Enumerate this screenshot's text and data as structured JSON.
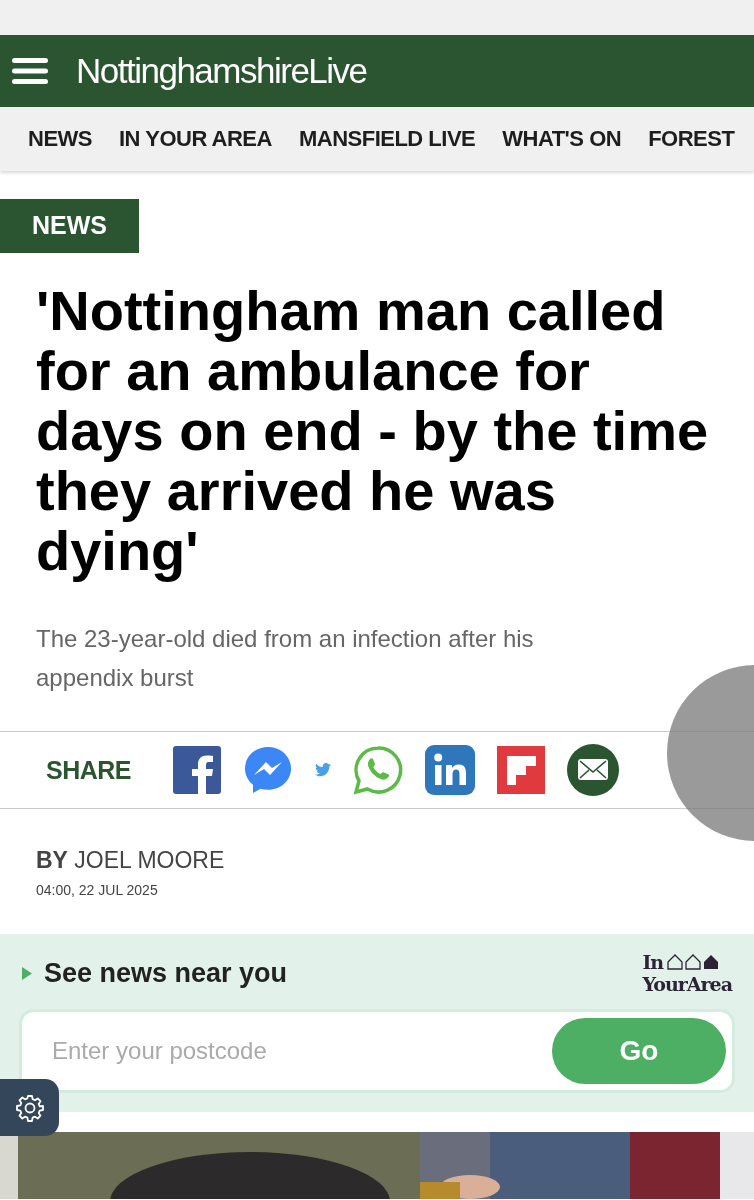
{
  "header": {
    "logo": "**Nottinghamshire**Live"
  },
  "nav": [
    {
      "label": "NEWS"
    },
    {
      "label": "IN YOUR AREA"
    },
    {
      "label": "MANSFIELD LIVE"
    },
    {
      "label": "WHAT'S ON"
    },
    {
      "label": "FOREST"
    }
  ],
  "article": {
    "section": "NEWS",
    "headline": "'Nottingham man called for an ambulance for days on end - by the time they arrived he was dying'",
    "standfirst": "The 23-year-old died from an infection after his appendix burst",
    "byline": "**BY** JOEL MOORE",
    "date": "04:00, 22 JUL 2025"
  },
  "share": {
    "label": "SHARE",
    "buttons": [
      {
        "kind": "facebook"
      },
      {
        "kind": "messenger"
      },
      {
        "kind": "twitter"
      },
      {
        "kind": "whatsapp"
      },
      {
        "kind": "linkedin"
      },
      {
        "kind": "flipboard"
      },
      {
        "kind": "email"
      }
    ]
  },
  "local_news": {
    "title": "See news near you",
    "logo_line1": "In",
    "logo_line2": "YourArea",
    "placeholder": "Enter your postcode",
    "button": "Go"
  }
}
